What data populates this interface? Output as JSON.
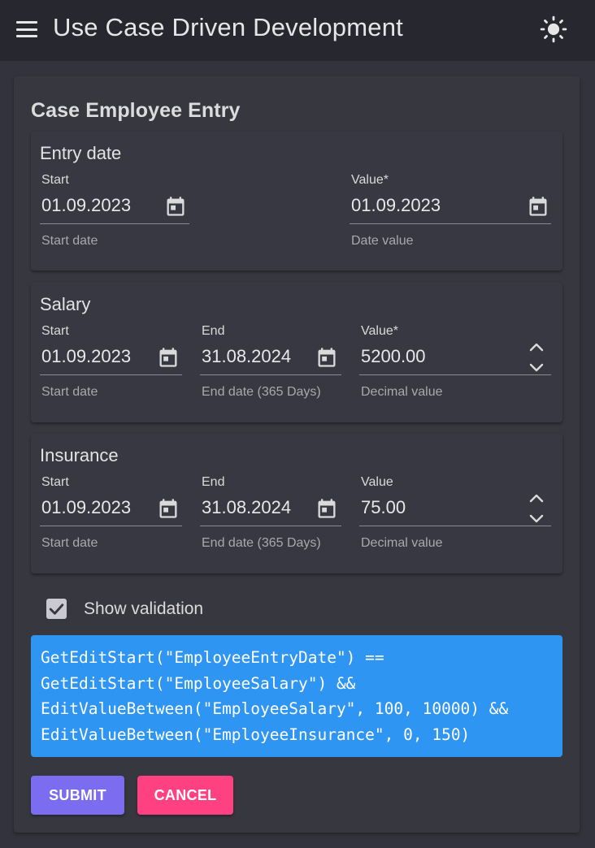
{
  "app": {
    "title": "Use Case Driven Development",
    "menu_icon": "menu-icon",
    "theme_icon": "sun-icon"
  },
  "form": {
    "title": "Case Employee Entry"
  },
  "sections": {
    "entry_date": {
      "title": "Entry date",
      "start": {
        "label": "Start",
        "value": "01.09.2023",
        "helper": "Start date"
      },
      "value": {
        "label": "Value*",
        "value": "01.09.2023",
        "helper": "Date value"
      }
    },
    "salary": {
      "title": "Salary",
      "start": {
        "label": "Start",
        "value": "01.09.2023",
        "helper": "Start date"
      },
      "end": {
        "label": "End",
        "value": "31.08.2024",
        "helper": "End date (365 Days)"
      },
      "value": {
        "label": "Value*",
        "value": "5200.00",
        "helper": "Decimal value"
      }
    },
    "insurance": {
      "title": "Insurance",
      "start": {
        "label": "Start",
        "value": "01.09.2023",
        "helper": "Start date"
      },
      "end": {
        "label": "End",
        "value": "31.08.2024",
        "helper": "End date (365 Days)"
      },
      "value": {
        "label": "Value",
        "value": "75.00",
        "helper": "Decimal value"
      }
    }
  },
  "validation": {
    "checkbox_label": "Show validation",
    "checked": true,
    "code_lines": [
      "GetEditStart(\"EmployeeEntryDate\") ==",
      "GetEditStart(\"EmployeeSalary\") &&",
      "EditValueBetween(\"EmployeeSalary\", 100, 10000) &&",
      "EditValueBetween(\"EmployeeInsurance\", 0, 150)"
    ]
  },
  "actions": {
    "submit_label": "SUBMIT",
    "cancel_label": "CANCEL"
  },
  "colors": {
    "app_bar": "#27272f",
    "background": "#32333d",
    "card": "#373740",
    "code_box": "#2f95f2",
    "submit": "#7b6cf0",
    "cancel": "#ff4081"
  }
}
